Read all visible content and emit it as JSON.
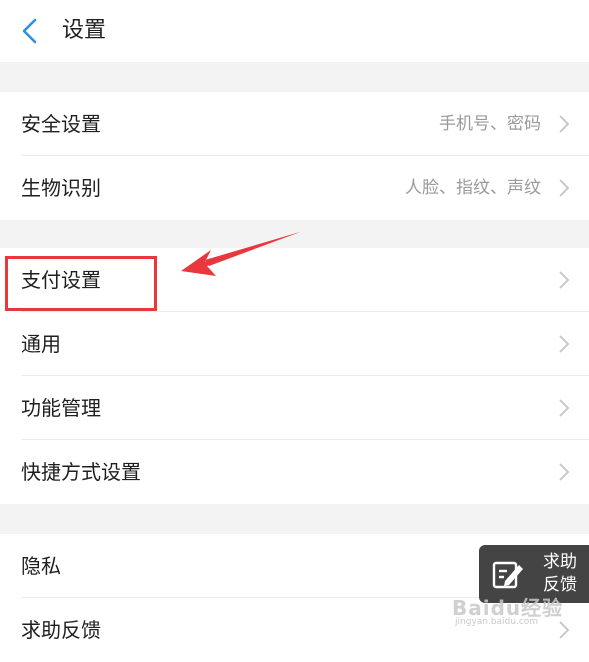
{
  "header": {
    "title": "设置"
  },
  "groups": [
    {
      "items": [
        {
          "label": "安全设置",
          "sub": "手机号、密码"
        },
        {
          "label": "生物识别",
          "sub": "人脸、指纹、声纹"
        }
      ]
    },
    {
      "items": [
        {
          "label": "支付设置",
          "sub": ""
        },
        {
          "label": "通用",
          "sub": ""
        },
        {
          "label": "功能管理",
          "sub": ""
        },
        {
          "label": "快捷方式设置",
          "sub": ""
        }
      ]
    },
    {
      "items": [
        {
          "label": "隐私",
          "sub": ""
        },
        {
          "label": "求助反馈",
          "sub": ""
        }
      ]
    }
  ],
  "help_widget": {
    "label_line1": "求助",
    "label_line2": "反馈"
  },
  "watermark": {
    "text": "Baidu经验",
    "sub": "jingyan.baidu.com"
  },
  "colors": {
    "accent": "#2f8fe6",
    "highlight": "#e8373d",
    "chevron": "#c4c4c4"
  },
  "icons": {
    "back": "chevron-left-icon",
    "row_arrow": "chevron-right-icon",
    "help": "edit-icon"
  }
}
